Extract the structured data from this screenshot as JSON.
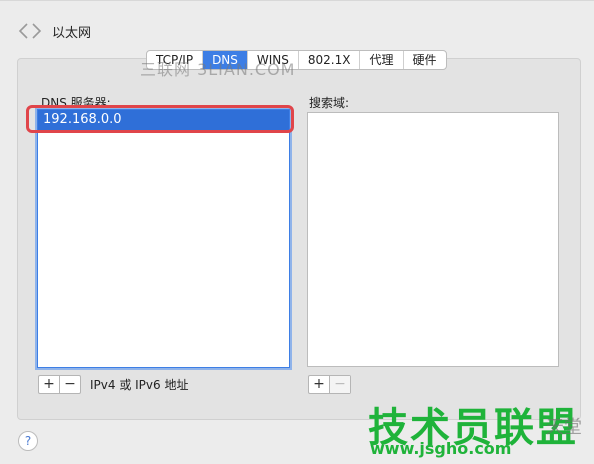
{
  "window": {
    "title": "以太网"
  },
  "tabs": [
    {
      "label": "TCP/IP",
      "active": false
    },
    {
      "label": "DNS",
      "active": true
    },
    {
      "label": "WINS",
      "active": false
    },
    {
      "label": "802.1X",
      "active": false
    },
    {
      "label": "代理",
      "active": false
    },
    {
      "label": "硬件",
      "active": false
    }
  ],
  "watermark_top": "三联网 3LIAN.COM",
  "dns": {
    "label": "DNS 服务器:",
    "servers": [
      "192.168.0.0"
    ],
    "note": "IPv4 或 IPv6 地址",
    "add_label": "+",
    "remove_label": "−"
  },
  "search_domains": {
    "label": "搜索域:",
    "items": [],
    "add_label": "+",
    "remove_label": "−"
  },
  "help_label": "?",
  "logo": {
    "main": "技术员联盟",
    "url": "www.jsgho.com",
    "side": "天堂"
  },
  "colors": {
    "accent": "#3d7ee5",
    "selection": "#2f6fd8",
    "highlight": "#e0454a",
    "logo_green": "#1fb33a"
  }
}
